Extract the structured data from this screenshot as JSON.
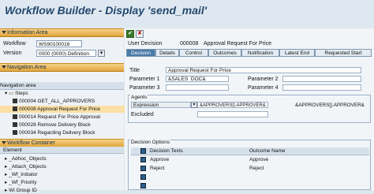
{
  "window": {
    "title": "Workflow Builder - Display 'send_mail'"
  },
  "left": {
    "info_area_label": "Information Area",
    "workflow_label": "Workflow",
    "workflow_value": "WS90100016",
    "version_label": "Version",
    "version_value": "0000 (0000) Definition",
    "nav_area_label": "Navigation Area",
    "nav_area_heading": "Navigation area",
    "tree": [
      {
        "label": "Steps"
      },
      {
        "label": "000004 GET_ALL_APPROVERS"
      },
      {
        "label": "000008 Approval Request For Price"
      },
      {
        "label": "000014 Request For Price Approval"
      },
      {
        "label": "000028 Remove Delivery Block"
      },
      {
        "label": "000034 Regarding Delivery Block"
      }
    ],
    "container_label": "Workflow Container",
    "container_header": "Element",
    "container_items": [
      {
        "label": "_Adhoc_Objects"
      },
      {
        "label": "_Attach_Objects"
      },
      {
        "label": "_Wf_Initiator"
      },
      {
        "label": "_Wf_Priority"
      },
      {
        "label": "Wi Group ID"
      }
    ]
  },
  "right": {
    "step_type": "User Decision",
    "step_number": "000008",
    "step_title": "Approval Request For Price",
    "tabs": [
      {
        "label": "Decision"
      },
      {
        "label": "Details"
      },
      {
        "label": "Control"
      },
      {
        "label": "Outcomes"
      },
      {
        "label": "Notification"
      },
      {
        "label": "Latest End"
      },
      {
        "label": "Requested Start"
      }
    ],
    "title_label": "Title",
    "title_value": "Approval Request For Price",
    "param1_label": "Parameter 1",
    "param1_value": "&SALES_DOC&",
    "param2_label": "Parameter 2",
    "param3_label": "Parameter 3",
    "param4_label": "Parameter 4",
    "agents_label": "Agents",
    "expression_label": "Expression",
    "expression_value": "&APPROVERS[].APPROVER&",
    "expression_display": "&APPROVERS[].APPROVER&",
    "excluded_label": "Excluded",
    "decision_options_label": "Decision Options",
    "table_headers": {
      "texts": "Decision Texts",
      "outcome": "Outcome Name"
    },
    "table_rows": [
      {
        "text": "Approve",
        "outcome": "Approve"
      },
      {
        "text": "Reject",
        "outcome": "Reject"
      }
    ]
  }
}
